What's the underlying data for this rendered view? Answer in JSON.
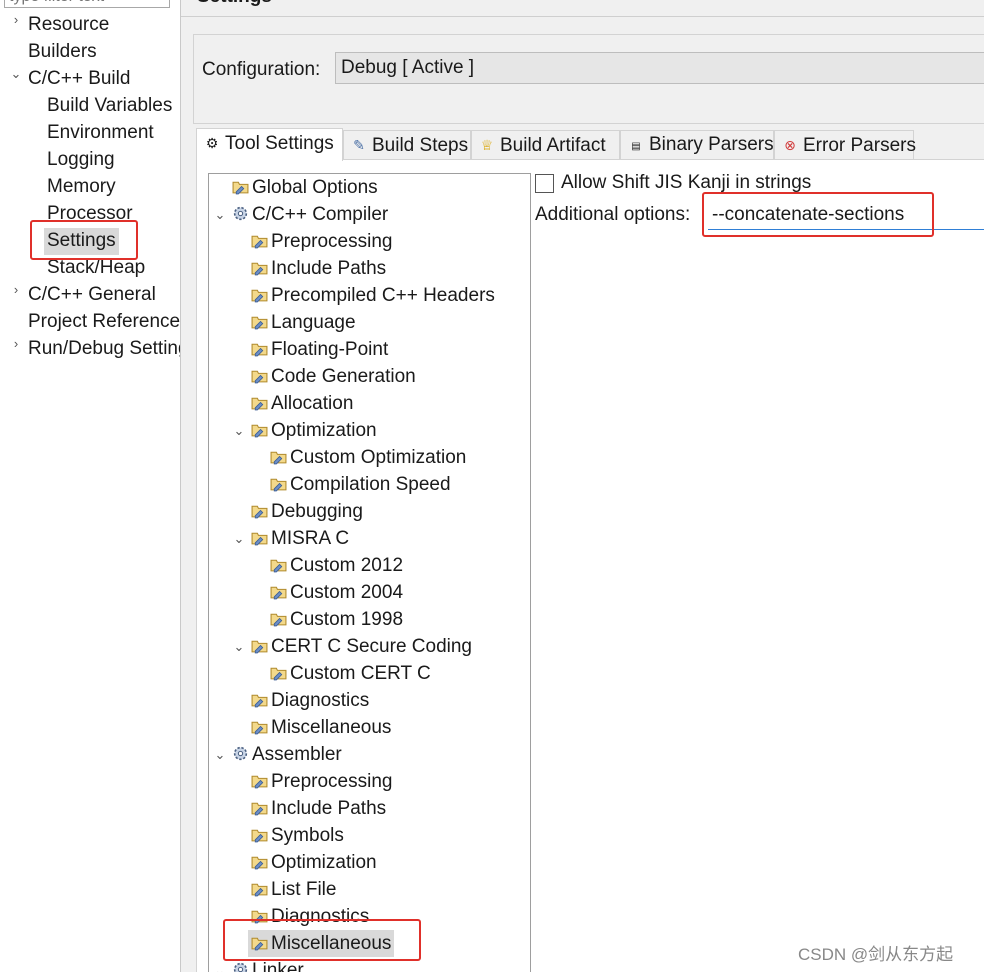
{
  "filter": {
    "placeholder": "type filter text"
  },
  "nav": {
    "resource": "Resource",
    "builders": "Builders",
    "cpp_build": "C/C++ Build",
    "build_variables": "Build Variables",
    "environment": "Environment",
    "logging": "Logging",
    "memory": "Memory",
    "processor": "Processor",
    "settings": "Settings",
    "stack_heap": "Stack/Heap",
    "cpp_general": "C/C++ General",
    "project_references": "Project References",
    "run_debug": "Run/Debug Settings"
  },
  "page": {
    "title": "Settings"
  },
  "config": {
    "label": "Configuration:",
    "value": "Debug  [ Active ]"
  },
  "tabs": {
    "tool_settings": "Tool Settings",
    "build_steps": "Build Steps",
    "build_artifact": "Build Artifact",
    "binary_parsers": "Binary Parsers",
    "error_parsers": "Error Parsers"
  },
  "tree": {
    "global_options": "Global Options",
    "compiler": "C/C++ Compiler",
    "c_preprocessing": "Preprocessing",
    "c_include_paths": "Include Paths",
    "c_precompiled": "Precompiled C++ Headers",
    "c_language": "Language",
    "c_floating": "Floating-Point",
    "c_codegen": "Code Generation",
    "c_allocation": "Allocation",
    "c_optimization": "Optimization",
    "c_custom_opt": "Custom Optimization",
    "c_compile_speed": "Compilation Speed",
    "c_debugging": "Debugging",
    "c_misra": "MISRA C",
    "c_custom_2012": "Custom 2012",
    "c_custom_2004": "Custom 2004",
    "c_custom_1998": "Custom 1998",
    "c_cert": "CERT C Secure Coding",
    "c_custom_cert": "Custom CERT C",
    "c_diagnostics": "Diagnostics",
    "c_misc": "Miscellaneous",
    "assembler": "Assembler",
    "a_preprocessing": "Preprocessing",
    "a_include_paths": "Include Paths",
    "a_symbols": "Symbols",
    "a_optimization": "Optimization",
    "a_list_file": "List File",
    "a_diagnostics": "Diagnostics",
    "a_misc": "Miscellaneous",
    "linker": "Linker"
  },
  "options": {
    "shift_jis_label": "Allow Shift JIS Kanji in strings",
    "shift_jis_checked": false,
    "additional_label": "Additional options:",
    "additional_value": "--concatenate-sections"
  },
  "watermark": "CSDN @剑从东方起",
  "colors": {
    "annotation": "#e0302a",
    "selection": "#d9d9d9",
    "input_focus": "#2f7fd6"
  }
}
